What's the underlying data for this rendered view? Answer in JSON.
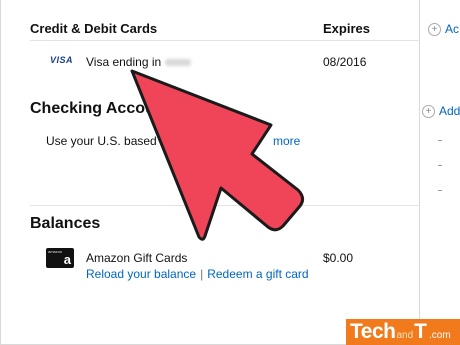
{
  "cards": {
    "heading": "Credit & Debit Cards",
    "expires_heading": "Expires",
    "add_label": "Ac",
    "brand": "VISA",
    "card_text": "Visa ending in",
    "expiry": "08/2016"
  },
  "checking": {
    "heading": "Checking Accou",
    "add_label": "Add",
    "desc": "Use your U.S. based c",
    "more_link": "more"
  },
  "balances": {
    "heading": "Balances",
    "gift_card_name": "Amazon Gift Cards",
    "amount": "$0.00",
    "reload_link": "Reload your balance",
    "separator": "|",
    "redeem_link": "Redeem a gift card"
  },
  "watermark": {
    "tech": "Tech",
    "and": "and",
    "t": "T",
    "com": ".com"
  },
  "colors": {
    "arrow": "#f04458",
    "link": "#0066c0",
    "watermark": "#f07a1c"
  }
}
